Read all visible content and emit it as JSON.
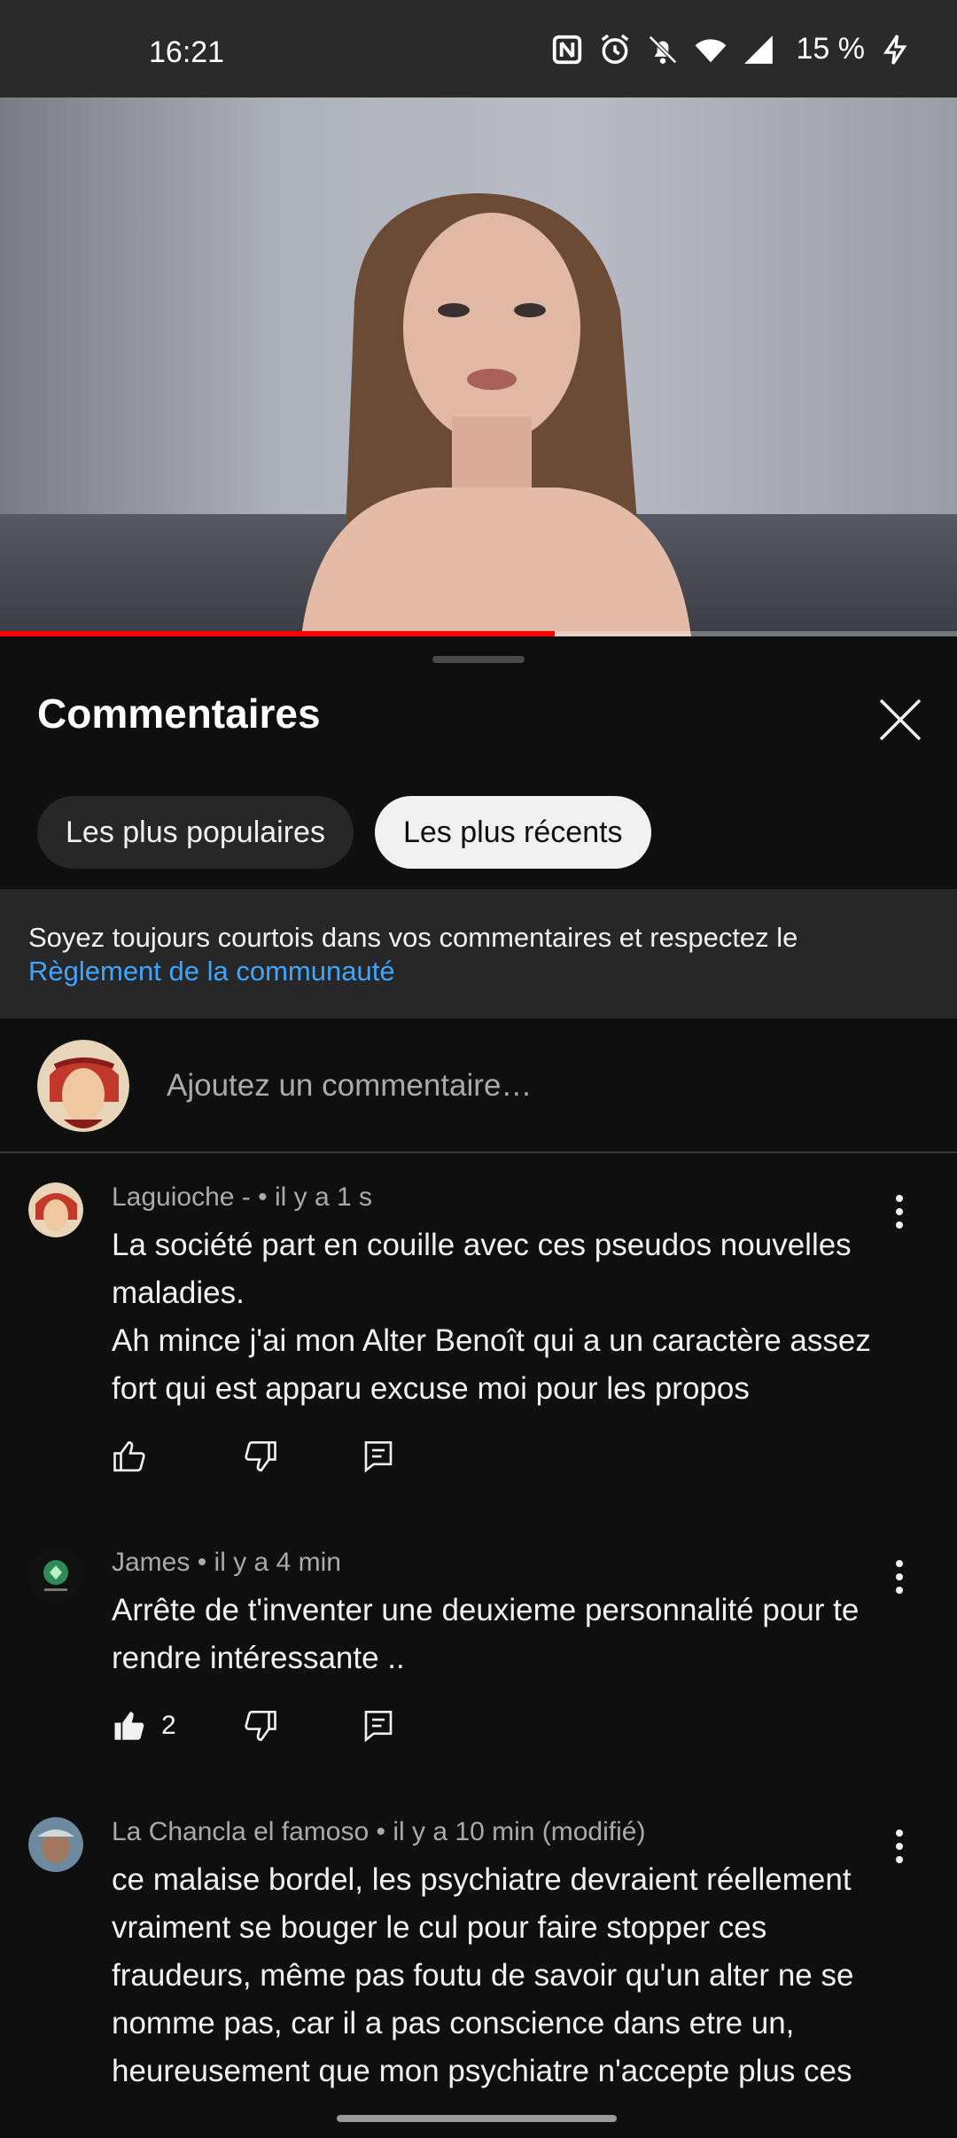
{
  "status_bar": {
    "time": "16:21",
    "battery": "15 %",
    "icons": [
      "nfc-icon",
      "alarm-icon",
      "bell-off-icon",
      "wifi-icon",
      "signal-icon",
      "charging-icon"
    ]
  },
  "video": {
    "progress_fraction": 0.58
  },
  "sheet": {
    "title": "Commentaires",
    "close_icon": "close-icon"
  },
  "filters": {
    "popular": "Les plus populaires",
    "recent": "Les plus récents",
    "selected": "recent"
  },
  "notice": {
    "text": "Soyez toujours courtois dans vos commentaires et respectez le",
    "link": "Règlement de la communauté"
  },
  "add_comment": {
    "placeholder": "Ajoutez un commentaire…"
  },
  "comments": [
    {
      "author": "Laguioche -",
      "time": "il y a 1 s",
      "paragraphs": [
        "La société part en couille avec ces pseudos nouvelles maladies.",
        "Ah mince j'ai mon Alter Benoît qui a un caractère assez fort qui est apparu excuse moi pour les propos"
      ],
      "likes": ""
    },
    {
      "author": "James",
      "time": "il y a 4 min",
      "paragraphs": [
        "Arrête de t'inventer une deuxieme personnalité pour te rendre intéressante .."
      ],
      "likes": "2"
    },
    {
      "author": "La Chancla el famoso",
      "time": "il y a 10 min (modifié)",
      "paragraphs": [
        "ce malaise bordel, les psychiatre devraient réellement vraiment se bouger le cul pour faire stopper ces fraudeurs, même pas foutu de savoir qu'un alter ne se nomme pas, car il a pas conscience dans etre un, heureusement que mon psychiatre n'accepte plus ces"
      ],
      "likes": ""
    }
  ],
  "colors": {
    "background": "#0f0f0f",
    "progress": "#ff0000",
    "link": "#3ea6ff",
    "chip_active": "#f1f1f1",
    "chip_inactive": "#272727"
  }
}
